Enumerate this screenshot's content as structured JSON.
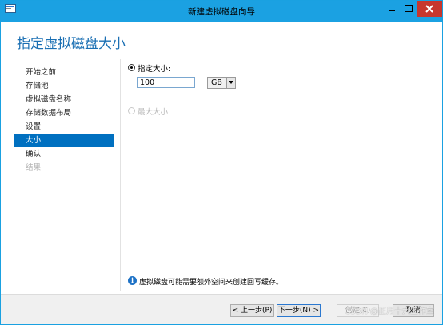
{
  "window": {
    "title": "新建虚拟磁盘向导",
    "icons": {
      "app": "wizard-icon",
      "minimize": "minimize-icon",
      "maximize": "maximize-icon",
      "close": "close-icon"
    },
    "colors": {
      "titlebar": "#1ba1e2",
      "close": "#c7372d",
      "accent": "#1a6fb3",
      "selected": "#0070c0"
    }
  },
  "header": {
    "title": "指定虚拟磁盘大小"
  },
  "nav": {
    "items": [
      {
        "label": "开始之前",
        "state": "normal"
      },
      {
        "label": "存储池",
        "state": "normal"
      },
      {
        "label": "虚拟磁盘名称",
        "state": "normal"
      },
      {
        "label": "存储数据布局",
        "state": "normal"
      },
      {
        "label": "设置",
        "state": "normal"
      },
      {
        "label": "大小",
        "state": "selected"
      },
      {
        "label": "确认",
        "state": "normal"
      },
      {
        "label": "结果",
        "state": "disabled"
      }
    ]
  },
  "size": {
    "specify_label": "指定大小:",
    "specify_selected": true,
    "value": "100",
    "unit": "GB",
    "max_label": "最大大小",
    "max_enabled": false
  },
  "info": {
    "icon": "info-icon",
    "text": "虚拟磁盘可能需要额外空间来创建回写缓存。"
  },
  "footer": {
    "prev": "< 上一步(P)",
    "next": "下一步(N) >",
    "create": "创建(C)",
    "cancel": "取消"
  },
  "watermark": "CSDN @正月十六工作室"
}
